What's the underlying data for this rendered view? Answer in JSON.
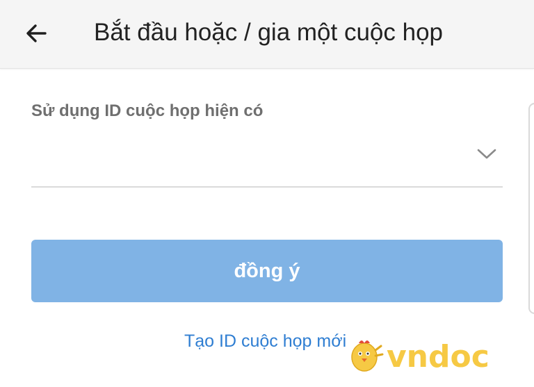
{
  "header": {
    "title": "Bắt đầu hoặc / gia một cuộc họp",
    "back_icon": "arrow-left-icon"
  },
  "meeting_id": {
    "label": "Sử dụng ID cuộc họp hiện có",
    "value": "",
    "dropdown_icon": "chevron-down-icon"
  },
  "confirm_button": {
    "label": "đồng ý"
  },
  "create_link": {
    "label": "Tạo ID cuộc họp mới"
  },
  "watermark": {
    "text": "vndoc",
    "color": "#f6c944"
  },
  "colors": {
    "primary": "#80b3e5",
    "link": "#2f7ed2",
    "appbar": "#f5f5f5"
  }
}
